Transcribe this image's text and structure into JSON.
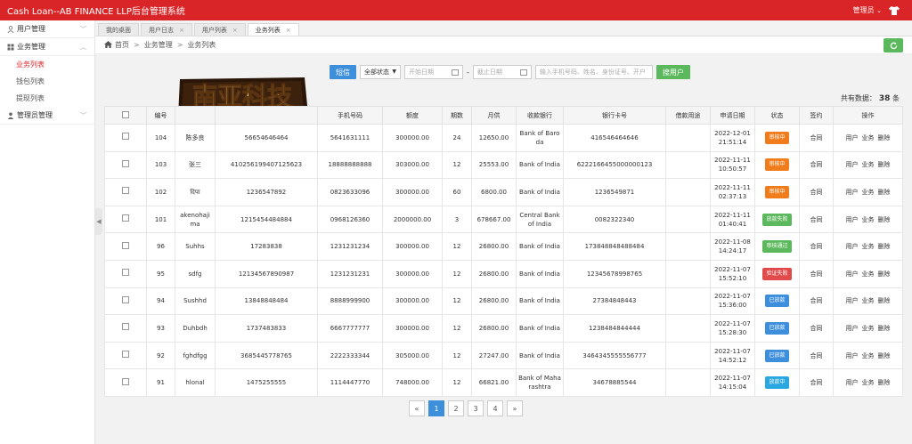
{
  "header": {
    "title": "Cash Loan--AB FINANCE LLP后台管理系统",
    "user_label": "管理员"
  },
  "sidebar": {
    "groups": [
      {
        "label": "用户管理",
        "icon": "user-icon",
        "expanded": false,
        "items": []
      },
      {
        "label": "业务管理",
        "icon": "folder-icon",
        "expanded": true,
        "items": [
          {
            "label": "业务列表",
            "active": true
          },
          {
            "label": "钱包列表",
            "active": false
          },
          {
            "label": "提现列表",
            "active": false
          }
        ]
      },
      {
        "label": "管理员管理",
        "icon": "admin-icon",
        "expanded": false,
        "items": []
      }
    ]
  },
  "tabs": [
    {
      "label": "我的桌面",
      "closable": false,
      "active": false
    },
    {
      "label": "用户日志",
      "closable": true,
      "active": false
    },
    {
      "label": "用户列表",
      "closable": true,
      "active": false
    },
    {
      "label": "业务列表",
      "closable": true,
      "active": true
    }
  ],
  "breadcrumb": [
    "首页",
    "业务管理",
    "业务列表"
  ],
  "filters": {
    "sms_button": "短信",
    "status_select": "全部状态",
    "start_date_placeholder": "开始日期",
    "date_separator": "-",
    "end_date_placeholder": "截止日期",
    "search_placeholder": "输入手机号码、姓名、身份证号、开户",
    "search_button": "搜用户"
  },
  "logo_text": "南亚科技",
  "summary": {
    "label": "共有数据：",
    "count": "38",
    "unit": "条"
  },
  "table": {
    "columns": [
      "",
      "编号",
      "",
      "",
      "手机号码",
      "额度",
      "期数",
      "月供",
      "收款银行",
      "银行卡号",
      "借款用途",
      "申请日期",
      "状态",
      "签约",
      "操作"
    ],
    "rows": [
      {
        "id": "104",
        "name": "陈多良",
        "idno": "56654646464",
        "phone": "5641631111",
        "amount": "300000.00",
        "term": "24",
        "monthly": "12650.00",
        "bank": "Bank of Baroda",
        "card": "416546464646",
        "purpose": "",
        "date": "2022-12-01 21:51:14",
        "status": "审核中",
        "status_color": "#f07c1b",
        "contract": "合同",
        "ops": [
          "用户",
          "业务",
          "删除"
        ]
      },
      {
        "id": "103",
        "name": "张三",
        "idno": "410256199407125623",
        "phone": "18888888888",
        "amount": "303000.00",
        "term": "12",
        "monthly": "25553.00",
        "bank": "Bank of India",
        "card": "6222166455000000123",
        "purpose": "",
        "date": "2022-11-11 10:50:57",
        "status": "审核中",
        "status_color": "#f07c1b",
        "contract": "合同",
        "ops": [
          "用户",
          "业务",
          "删除"
        ]
      },
      {
        "id": "102",
        "name": "दिपा",
        "idno": "1236547892",
        "phone": "0823633096",
        "amount": "300000.00",
        "term": "60",
        "monthly": "6800.00",
        "bank": "Bank of India",
        "card": "1236549871",
        "purpose": "",
        "date": "2022-11-11 02:37:13",
        "status": "审核中",
        "status_color": "#f07c1b",
        "contract": "合同",
        "ops": [
          "用户",
          "业务",
          "删除"
        ]
      },
      {
        "id": "101",
        "name": "akenohajima",
        "idno": "1215454484884",
        "phone": "0968126360",
        "amount": "2000000.00",
        "term": "3",
        "monthly": "678667.00",
        "bank": "Central Bank of India",
        "card": "0082322340",
        "purpose": "",
        "date": "2022-11-11 01:40:41",
        "status": "放款失败",
        "status_color": "#5cb85c",
        "contract": "合同",
        "ops": [
          "用户",
          "业务",
          "删除"
        ]
      },
      {
        "id": "96",
        "name": "Suhhs",
        "idno": "17283838",
        "phone": "1231231234",
        "amount": "300000.00",
        "term": "12",
        "monthly": "26800.00",
        "bank": "Bank of India",
        "card": "173848848488484",
        "purpose": "",
        "date": "2022-11-08 14:24:17",
        "status": "审核通过",
        "status_color": "#5cb85c",
        "contract": "合同",
        "ops": [
          "用户",
          "业务",
          "删除"
        ]
      },
      {
        "id": "95",
        "name": "sdfg",
        "idno": "12134567890987",
        "phone": "1231231231",
        "amount": "300000.00",
        "term": "12",
        "monthly": "26800.00",
        "bank": "Bank of India",
        "card": "12345678998765",
        "purpose": "",
        "date": "2022-11-07 15:52:10",
        "status": "验证失败",
        "status_color": "#e04a4a",
        "contract": "合同",
        "ops": [
          "用户",
          "业务",
          "删除"
        ]
      },
      {
        "id": "94",
        "name": "Sushhd",
        "idno": "13848848484",
        "phone": "8888999900",
        "amount": "300000.00",
        "term": "12",
        "monthly": "26800.00",
        "bank": "Bank of India",
        "card": "27384848443",
        "purpose": "",
        "date": "2022-11-07 15:36:00",
        "status": "已放款",
        "status_color": "#3d8fdc",
        "contract": "合同",
        "ops": [
          "用户",
          "业务",
          "删除"
        ]
      },
      {
        "id": "93",
        "name": "Duhbdh",
        "idno": "1737483833",
        "phone": "6667777777",
        "amount": "300000.00",
        "term": "12",
        "monthly": "26800.00",
        "bank": "Bank of India",
        "card": "1238484844444",
        "purpose": "",
        "date": "2022-11-07 15:28:30",
        "status": "已放款",
        "status_color": "#3d8fdc",
        "contract": "合同",
        "ops": [
          "用户",
          "业务",
          "删除"
        ]
      },
      {
        "id": "92",
        "name": "fghdfgg",
        "idno": "3685445778765",
        "phone": "2222333344",
        "amount": "305000.00",
        "term": "12",
        "monthly": "27247.00",
        "bank": "Bank of India",
        "card": "3464345555556777",
        "purpose": "",
        "date": "2022-11-07 14:52:12",
        "status": "已放款",
        "status_color": "#3d8fdc",
        "contract": "合同",
        "ops": [
          "用户",
          "业务",
          "删除"
        ]
      },
      {
        "id": "91",
        "name": "hlonal",
        "idno": "1475255555",
        "phone": "1114447770",
        "amount": "748000.00",
        "term": "12",
        "monthly": "66821.00",
        "bank": "Bank of Maharashtra",
        "card": "34678885544",
        "purpose": "",
        "date": "2022-11-07 14:15:04",
        "status": "放款中",
        "status_color": "#2aa7e0",
        "contract": "合同",
        "ops": [
          "用户",
          "业务",
          "删除"
        ]
      }
    ]
  },
  "pagination": {
    "prev": "«",
    "pages": [
      "1",
      "2",
      "3",
      "4"
    ],
    "current": "1",
    "next": "»"
  }
}
